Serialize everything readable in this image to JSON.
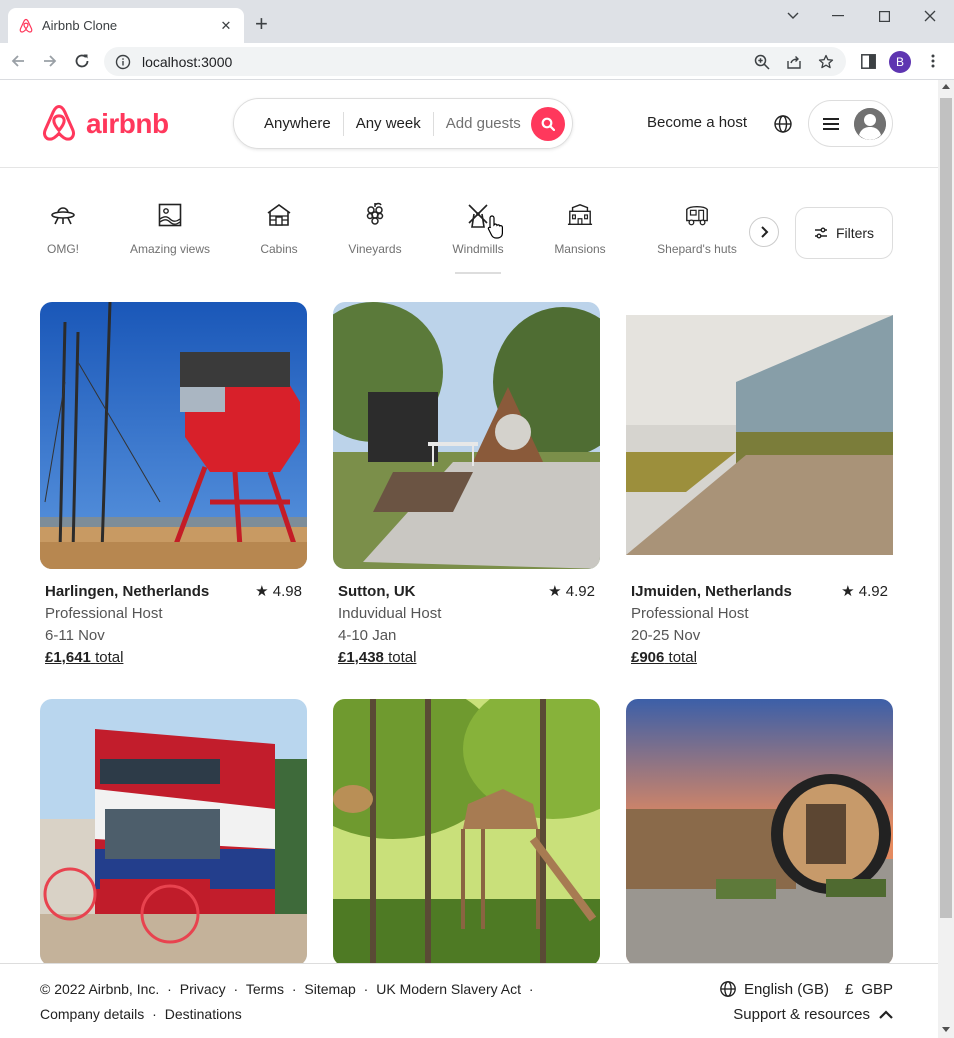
{
  "browser": {
    "tab_title": "Airbnb Clone",
    "url": "localhost:3000",
    "profile_initial": "B",
    "new_tab_symbol": "+",
    "close_symbol": "✕"
  },
  "header": {
    "logo_text": "airbnb",
    "search": {
      "where": "Anywhere",
      "when": "Any week",
      "guests": "Add guests"
    },
    "host_link": "Become a host",
    "brand_color": "#ff385c"
  },
  "categories": {
    "items": [
      {
        "label": "OMG!",
        "icon": "ufo-icon"
      },
      {
        "label": "Amazing views",
        "icon": "picture-icon"
      },
      {
        "label": "Cabins",
        "icon": "cabin-icon"
      },
      {
        "label": "Vineyards",
        "icon": "grapes-icon"
      },
      {
        "label": "Windmills",
        "icon": "windmill-icon"
      },
      {
        "label": "Mansions",
        "icon": "mansion-icon"
      },
      {
        "label": "Shepard's huts",
        "icon": "hut-icon"
      }
    ],
    "active": "Windmills",
    "filters_label": "Filters"
  },
  "listings": [
    {
      "location": "Harlingen, Netherlands",
      "rating": "4.98",
      "host": "Professional Host",
      "dates": "6-11 Nov",
      "price": "£1,641",
      "price_suffix": "total"
    },
    {
      "location": "Sutton, UK",
      "rating": "4.92",
      "host": "Induvidual Host",
      "dates": "4-10 Jan",
      "price": "£1,438",
      "price_suffix": "total"
    },
    {
      "location": "IJmuiden, Netherlands",
      "rating": "4.92",
      "host": "Professional Host",
      "dates": "20-25 Nov",
      "price": "£906",
      "price_suffix": "total"
    },
    {
      "location": "",
      "rating": "",
      "host": "",
      "dates": "",
      "price": "",
      "price_suffix": ""
    },
    {
      "location": "",
      "rating": "",
      "host": "",
      "dates": "",
      "price": "",
      "price_suffix": ""
    },
    {
      "location": "",
      "rating": "",
      "host": "",
      "dates": "",
      "price": "",
      "price_suffix": ""
    }
  ],
  "footer": {
    "copyright": "© 2022 Airbnb, Inc.",
    "links": [
      "Privacy",
      "Terms",
      "Sitemap",
      "UK Modern Slavery Act"
    ],
    "links2": [
      "Company details",
      "Destinations"
    ],
    "separator": "·",
    "language": "English (GB)",
    "currency_symbol": "£",
    "currency": "GBP",
    "support": "Support & resources"
  }
}
